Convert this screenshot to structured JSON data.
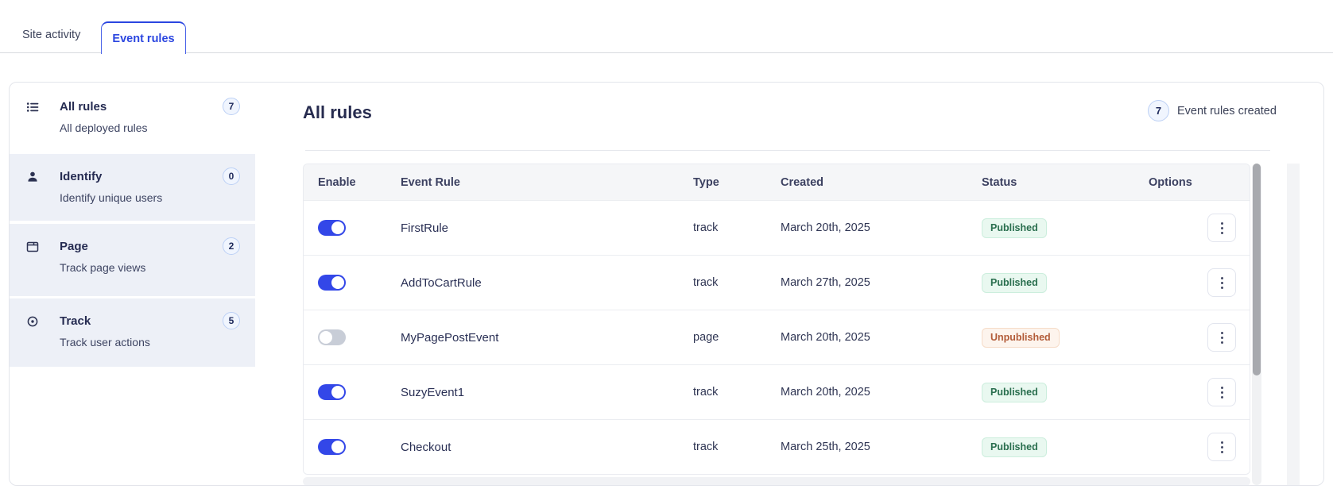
{
  "tabs": [
    {
      "label": "Site activity",
      "active": false
    },
    {
      "label": "Event rules",
      "active": true
    }
  ],
  "sidebar": {
    "items": [
      {
        "icon": "list-icon",
        "title": "All rules",
        "subtitle": "All deployed rules",
        "count": "7",
        "selected": true
      },
      {
        "icon": "user-icon",
        "title": "Identify",
        "subtitle": "Identify unique users",
        "count": "0",
        "selected": false
      },
      {
        "icon": "window-icon",
        "title": "Page",
        "subtitle": "Track page views",
        "count": "2",
        "selected": false
      },
      {
        "icon": "target-icon",
        "title": "Track",
        "subtitle": "Track user actions",
        "count": "5",
        "selected": false
      }
    ]
  },
  "main": {
    "title": "All rules",
    "summary": {
      "count": "7",
      "label": "Event rules created"
    },
    "table": {
      "columns": [
        "Enable",
        "Event Rule",
        "Type",
        "Created",
        "Status",
        "Options"
      ],
      "rows": [
        {
          "enabled": true,
          "name": "FirstRule",
          "type": "track",
          "created": "March 20th, 2025",
          "status": "Published"
        },
        {
          "enabled": true,
          "name": "AddToCartRule",
          "type": "track",
          "created": "March 27th, 2025",
          "status": "Published"
        },
        {
          "enabled": false,
          "name": "MyPagePostEvent",
          "type": "page",
          "created": "March 20th, 2025",
          "status": "Unpublished"
        },
        {
          "enabled": true,
          "name": "SuzyEvent1",
          "type": "track",
          "created": "March 20th, 2025",
          "status": "Published"
        },
        {
          "enabled": true,
          "name": "Checkout",
          "type": "track",
          "created": "March 25th, 2025",
          "status": "Published"
        }
      ]
    }
  },
  "colors": {
    "accent_blue": "#2b46e0",
    "toggle_on": "#3347e8",
    "toggle_off": "#c8cdd7",
    "published_text": "#296e4e",
    "published_bg": "#e9f8f0",
    "unpublished_text": "#b25b38",
    "unpublished_bg": "#fdf4ed",
    "badge_bg": "#f0f5fe",
    "badge_border": "#bcd0f5",
    "header_bg": "#f5f6f8",
    "sidebar_item_bg": "#edf0f7"
  }
}
